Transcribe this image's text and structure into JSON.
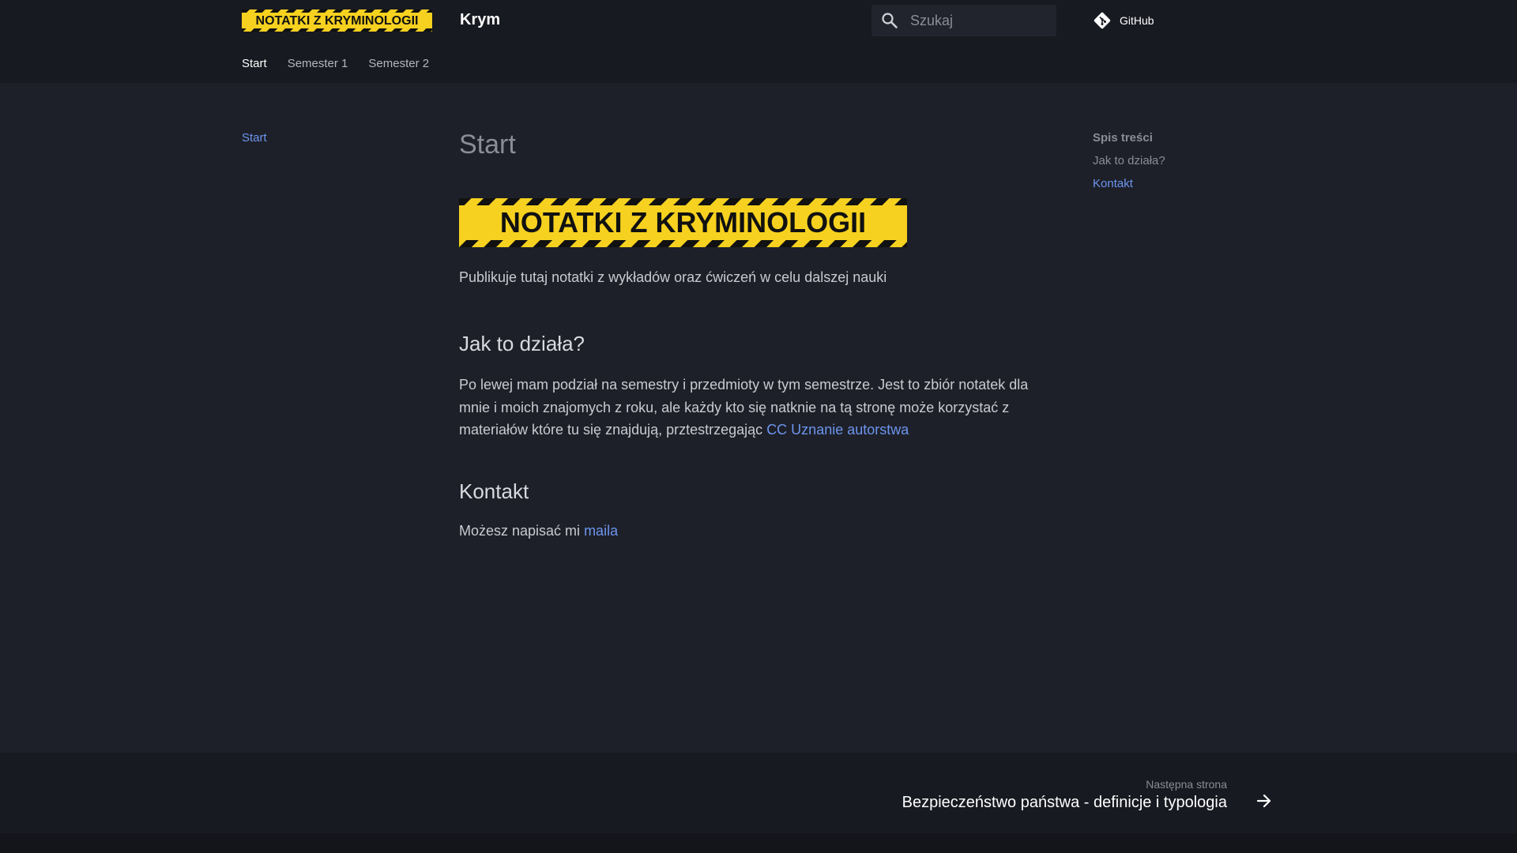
{
  "header": {
    "logo_text": "NOTATKI Z KRYMINOLOGII",
    "site_title": "Krym",
    "search_placeholder": "Szukaj",
    "github_label": "GitHub"
  },
  "tabs": [
    {
      "label": "Start",
      "active": true
    },
    {
      "label": "Semester 1",
      "active": false
    },
    {
      "label": "Semester 2",
      "active": false
    }
  ],
  "sidebar": {
    "items": [
      {
        "label": "Start"
      }
    ]
  },
  "main": {
    "title": "Start",
    "banner_text": "NOTATKI Z KRYMINOLOGII",
    "intro": "Publikuje tutaj notatki z wykładów oraz ćwiczeń w celu dalszej nauki",
    "section1_heading": "Jak to działa?",
    "section1_text": "Po lewej mam podział na semestry i przedmioty w tym semestrze. Jest to zbiór notatek dla mnie i moich znajomych z roku, ale każdy kto się natknie na tą stronę może korzystać z materiałów które tu się znajdują, prztestrzegając ",
    "section1_link": "CC Uznanie autorstwa",
    "section2_heading": "Kontakt",
    "section2_text": "Możesz napisać mi ",
    "section2_link": "maila"
  },
  "toc": {
    "title": "Spis treści",
    "items": [
      {
        "label": "Jak to działa?"
      },
      {
        "label": "Kontakt"
      }
    ]
  },
  "footer": {
    "next_label": "Następna strona",
    "next_title": "Bezpieczeństwo państwa - definicje i typologia"
  },
  "colors": {
    "background": "#1e2029",
    "header_bg": "#181a21",
    "accent": "#6c95ee",
    "banner_yellow": "#f6d11f"
  }
}
